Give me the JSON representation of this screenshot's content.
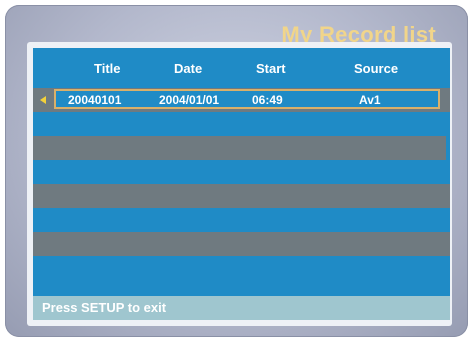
{
  "page_title": "My Record list",
  "columns": [
    "Title",
    "Date",
    "Start",
    "Source"
  ],
  "records": [
    {
      "title": "20040101",
      "date": "2004/01/01",
      "start": "06:49",
      "source": "Av1"
    }
  ],
  "footer_hint": "Press SETUP to exit",
  "colors": {
    "title_accent": "#f1d58a",
    "row_blue": "#1f8bc6",
    "row_gray": "#6f7a80",
    "selection_border": "#d9b06a",
    "selection_arrow": "#f3d23a",
    "footer_bar": "#9fc6cf"
  },
  "icons": {
    "selection_arrow": "left-triangle-icon"
  }
}
